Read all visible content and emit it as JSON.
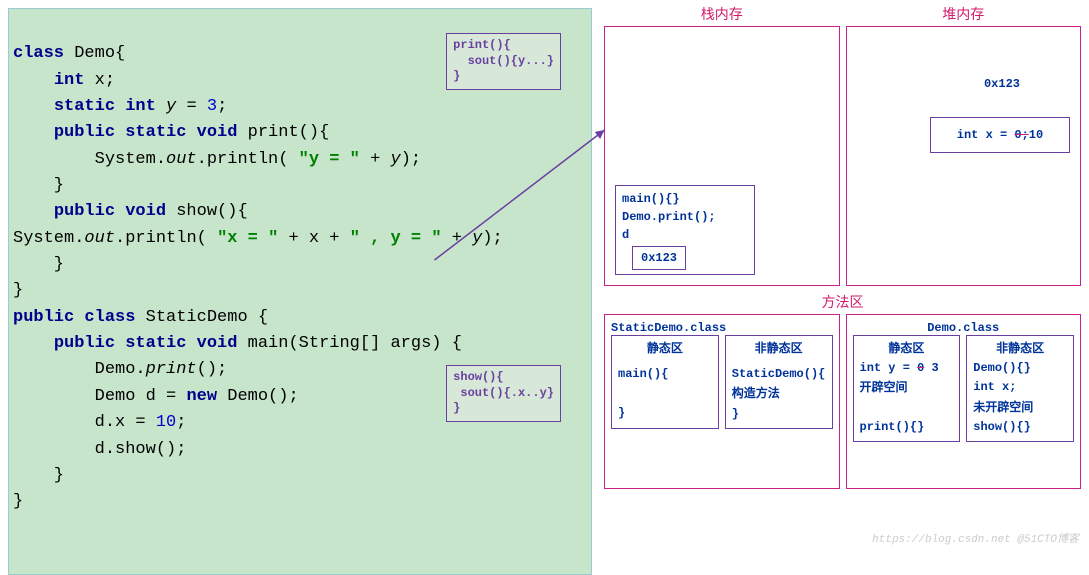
{
  "code": {
    "l1": "class Demo{",
    "l2": "    int x;",
    "l3": "    static int y = 3;",
    "l4": "    public static void print(){",
    "l5": "        System.out.println( \"y = \" + y);",
    "l6": "    }",
    "l7": "    public void show(){",
    "l8": "System.out.println( \"x = \" + x + \" , y = \" + y);",
    "l9": "    }",
    "l10": "}",
    "l11": "public class StaticDemo {",
    "l12": "    public static void main(String[] args) {",
    "l13": "        Demo.print();",
    "l14": "        Demo d = new Demo();",
    "l15": "        d.x = 10;",
    "l16": "        d.show();",
    "l17": "    }",
    "l18": "}"
  },
  "anno1": {
    "l1": "print(){",
    "l2": "  sout(){y...}",
    "l3": "}"
  },
  "anno2": {
    "l1": "show(){",
    "l2": " sout(){.x..y}",
    "l3": "}"
  },
  "headers": {
    "stack": "栈内存",
    "heap": "堆内存",
    "method": "方法区"
  },
  "stack": {
    "main1": "main(){}",
    "main2": "Demo.print();",
    "main3": "d",
    "addr": "0x123"
  },
  "heap": {
    "addr": "0x123",
    "field": "int x = ",
    "old": "0;",
    "new": "10"
  },
  "method_area": {
    "box1": {
      "title": "StaticDemo.class",
      "col1_head": "静态区",
      "col2_head": "非静态区",
      "col1_l1": "main(){",
      "col1_l2": "}",
      "col2_l1": "StaticDemo(){",
      "col2_l2": "构造方法",
      "col2_l3": "}"
    },
    "box2": {
      "title": "Demo.class",
      "col1_head": "静态区",
      "col2_head": "非静态区",
      "col1_l1": "int y = ",
      "col1_old": "0",
      "col1_new": " 3",
      "col1_l2": "开辟空间",
      "col1_l3": "print(){}",
      "col2_l1": "Demo(){}",
      "col2_l2": "int x;",
      "col2_l3": "未开辟空间",
      "col2_l4": "show(){}"
    }
  },
  "watermark": "https://blog.csdn.net @51CTO博客"
}
